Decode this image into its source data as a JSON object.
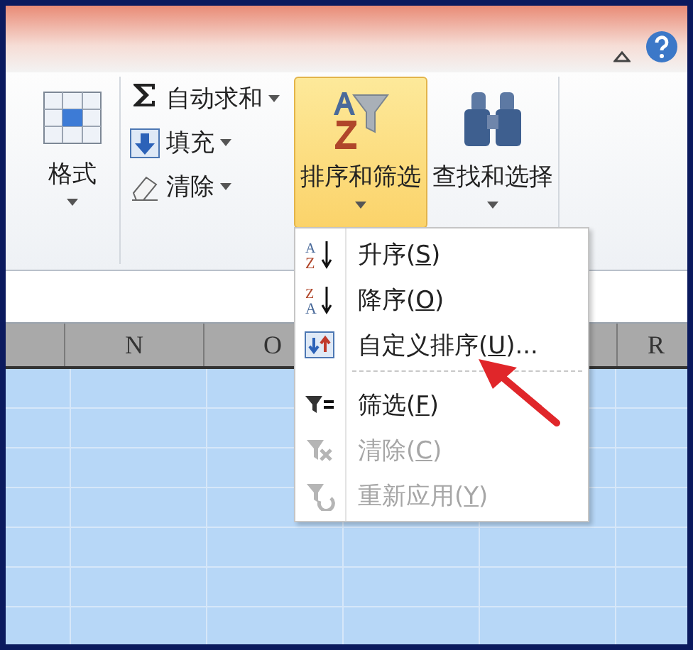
{
  "ribbon": {
    "format_button": {
      "label": "格式"
    },
    "edit_items": [
      {
        "kind": "sum",
        "label": "自动求和"
      },
      {
        "kind": "fill",
        "label": "填充"
      },
      {
        "kind": "clear",
        "label": "清除"
      }
    ],
    "buttons": [
      {
        "kind": "sort",
        "label": "排序和筛选",
        "selected": true
      },
      {
        "kind": "find",
        "label": "查找和选择",
        "selected": false
      }
    ]
  },
  "columns": [
    {},
    {
      "label": "N"
    },
    {
      "label": "O"
    },
    {},
    {},
    {
      "label": "R"
    }
  ],
  "menu": {
    "items": [
      {
        "kind": "asc",
        "icon_top": "A",
        "icon_bottom": "Z",
        "before": "升序(",
        "key": "S",
        "after": ")",
        "disabled": false
      },
      {
        "kind": "desc",
        "icon_top": "Z",
        "icon_bottom": "A",
        "before": "降序(",
        "key": "O",
        "after": ")",
        "disabled": false
      },
      {
        "kind": "custom",
        "before": "自定义排序(",
        "key": "U",
        "after": ")...",
        "disabled": false
      },
      {
        "kind": "separator"
      },
      {
        "kind": "filter",
        "before": "筛选(",
        "key": "F",
        "after": ")",
        "disabled": false
      },
      {
        "kind": "clear",
        "before": "清除(",
        "key": "C",
        "after": ")",
        "disabled": true
      },
      {
        "kind": "reapply",
        "before": "重新应用(",
        "key": "Y",
        "after": ")",
        "disabled": true
      }
    ]
  }
}
